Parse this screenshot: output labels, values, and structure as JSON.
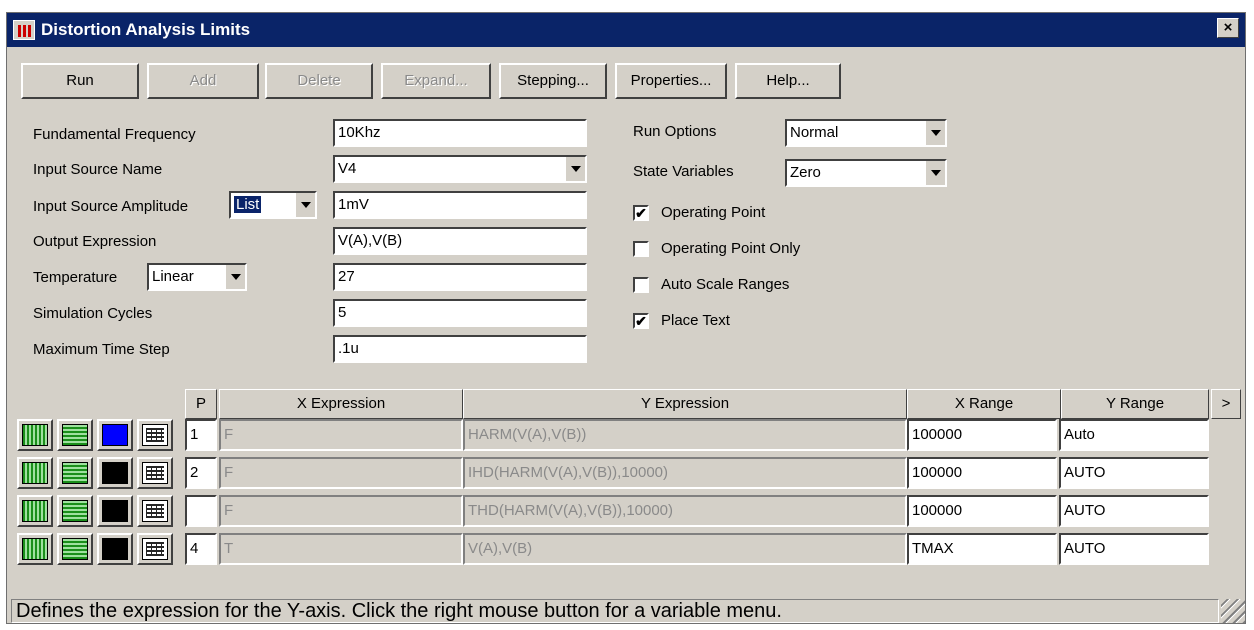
{
  "window": {
    "title": "Distortion Analysis Limits",
    "close": "×"
  },
  "toolbar": {
    "run": "Run",
    "add": "Add",
    "delete": "Delete",
    "expand": "Expand...",
    "stepping": "Stepping...",
    "properties": "Properties...",
    "help": "Help..."
  },
  "form": {
    "fundamental_frequency": {
      "label": "Fundamental Frequency",
      "value": "10Khz"
    },
    "input_source_name": {
      "label": "Input Source Name",
      "value": "V4"
    },
    "input_source_amplitude": {
      "label": "Input Source Amplitude",
      "mode": "List",
      "value": "1mV"
    },
    "output_expression": {
      "label": "Output Expression",
      "value": "V(A),V(B)"
    },
    "temperature": {
      "label": "Temperature",
      "mode": "Linear",
      "value": "27"
    },
    "simulation_cycles": {
      "label": "Simulation Cycles",
      "value": "5"
    },
    "maximum_time_step": {
      "label": "Maximum Time Step",
      "value": ".1u"
    }
  },
  "options": {
    "run_options": {
      "label": "Run Options",
      "value": "Normal"
    },
    "state_variables": {
      "label": "State Variables",
      "value": "Zero"
    },
    "checkboxes": [
      {
        "label": "Operating Point",
        "checked": true,
        "mark": "✔"
      },
      {
        "label": "Operating Point Only",
        "checked": false,
        "mark": ""
      },
      {
        "label": "Auto Scale Ranges",
        "checked": false,
        "mark": ""
      },
      {
        "label": "Place Text",
        "checked": true,
        "mark": "✔"
      }
    ]
  },
  "table": {
    "headers": {
      "p": "P",
      "x_expression": "X Expression",
      "y_expression": "Y Expression",
      "x_range": "X Range",
      "y_range": "Y Range",
      "more": ">"
    },
    "rows": [
      {
        "p": "1",
        "x": "F",
        "y": "HARM(V(A),V(B))",
        "x_range": "100000",
        "y_range": "Auto",
        "color": "#0000ff"
      },
      {
        "p": "2",
        "x": "F",
        "y": "IHD(HARM(V(A),V(B)),10000)",
        "x_range": "100000",
        "y_range": "AUTO",
        "color": "#000000"
      },
      {
        "p": "",
        "x": "F",
        "y": "THD(HARM(V(A),V(B)),10000)",
        "x_range": "100000",
        "y_range": "AUTO",
        "color": "#000000"
      },
      {
        "p": "4",
        "x": "T",
        "y": "V(A),V(B)",
        "x_range": "TMAX",
        "y_range": "AUTO",
        "color": "#000000"
      }
    ]
  },
  "status": {
    "text": "Defines the expression for the Y-axis. Click the right mouse button for a variable menu."
  },
  "icons": {
    "app": "chart-icon",
    "vertical_grid": "vertical-lines-icon",
    "horizontal_grid": "horizontal-lines-icon",
    "color": "color-swatch-icon",
    "format": "number-format-icon"
  }
}
